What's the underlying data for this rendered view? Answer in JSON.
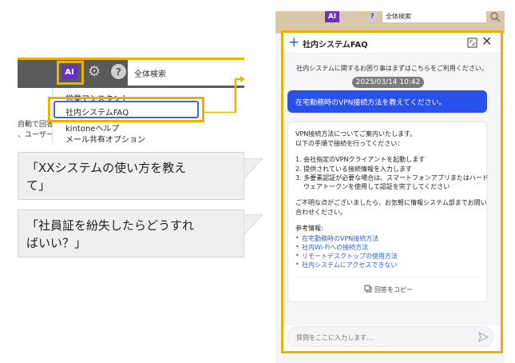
{
  "left_mock": {
    "toolbar": {
      "ai_label": "AI",
      "search_label": "全体検索",
      "icons": [
        "ai-icon",
        "gear-icon",
        "help-icon"
      ]
    },
    "dropdown": {
      "items": [
        "営業アシスタント",
        "社内システムFAQ",
        "kintoneヘルプ",
        "メール共有オプション"
      ],
      "selected": "社内システムFAQ"
    },
    "bg_text_lines": [
      "自動で回答",
      "、ユーザー"
    ]
  },
  "bubbles": [
    {
      "text_line1": "「XXシステムの使い方を教え",
      "text_line2": "て」"
    },
    {
      "text_line1": "「社員証を紛失したらどうすれ",
      "text_line2": "ばいい？」"
    }
  ],
  "chat_panel": {
    "top_bar": {
      "ai_label": "AI",
      "search_label": "全体検索"
    },
    "header": {
      "title": "社内システムFAQ",
      "add_icon": "plus-icon",
      "expand_icon": "expand-icon",
      "close_icon": "close-icon"
    },
    "intro": "社内システムに関するお困り事はまずはこちらをご利用ください。",
    "date": "2025/03/14 10:42",
    "user_message": "在宅勤務時のVPN接続方法を教えてください。",
    "bot_reply": {
      "line1": "VPN接続方法についてご案内いたします。",
      "line2": "以下の手順で接続を行ってください：",
      "steps": [
        "1. 会社指定のVPNクライアントを起動します",
        "2. 提供されている接続情報を入力します",
        "3. 多要素認証が必要な場合は、スマートフォンアプリまたはハード",
        "ウェアトークンを使用して認証を完了してください"
      ],
      "closing1": "ご不明な点がございましたら、お気軽に情報システム部までお問い",
      "closing2": "合わせください。",
      "ref_title": "参考情報:",
      "refs": [
        "在宅勤務時のVPN接続方法",
        "社内Wi-Fiへの接続方法",
        "リモートデスクトップの使用方法",
        "社内システムにアクセスできない"
      ],
      "copy_label": "回答をコピー"
    },
    "input_placeholder": "質問をここに入力します...",
    "send_icon": "send-icon"
  },
  "colors": {
    "highlight": "#e9b200",
    "accent": "#2950e8",
    "ai_purple": "#6b2fbf",
    "link": "#2c5fd0"
  }
}
